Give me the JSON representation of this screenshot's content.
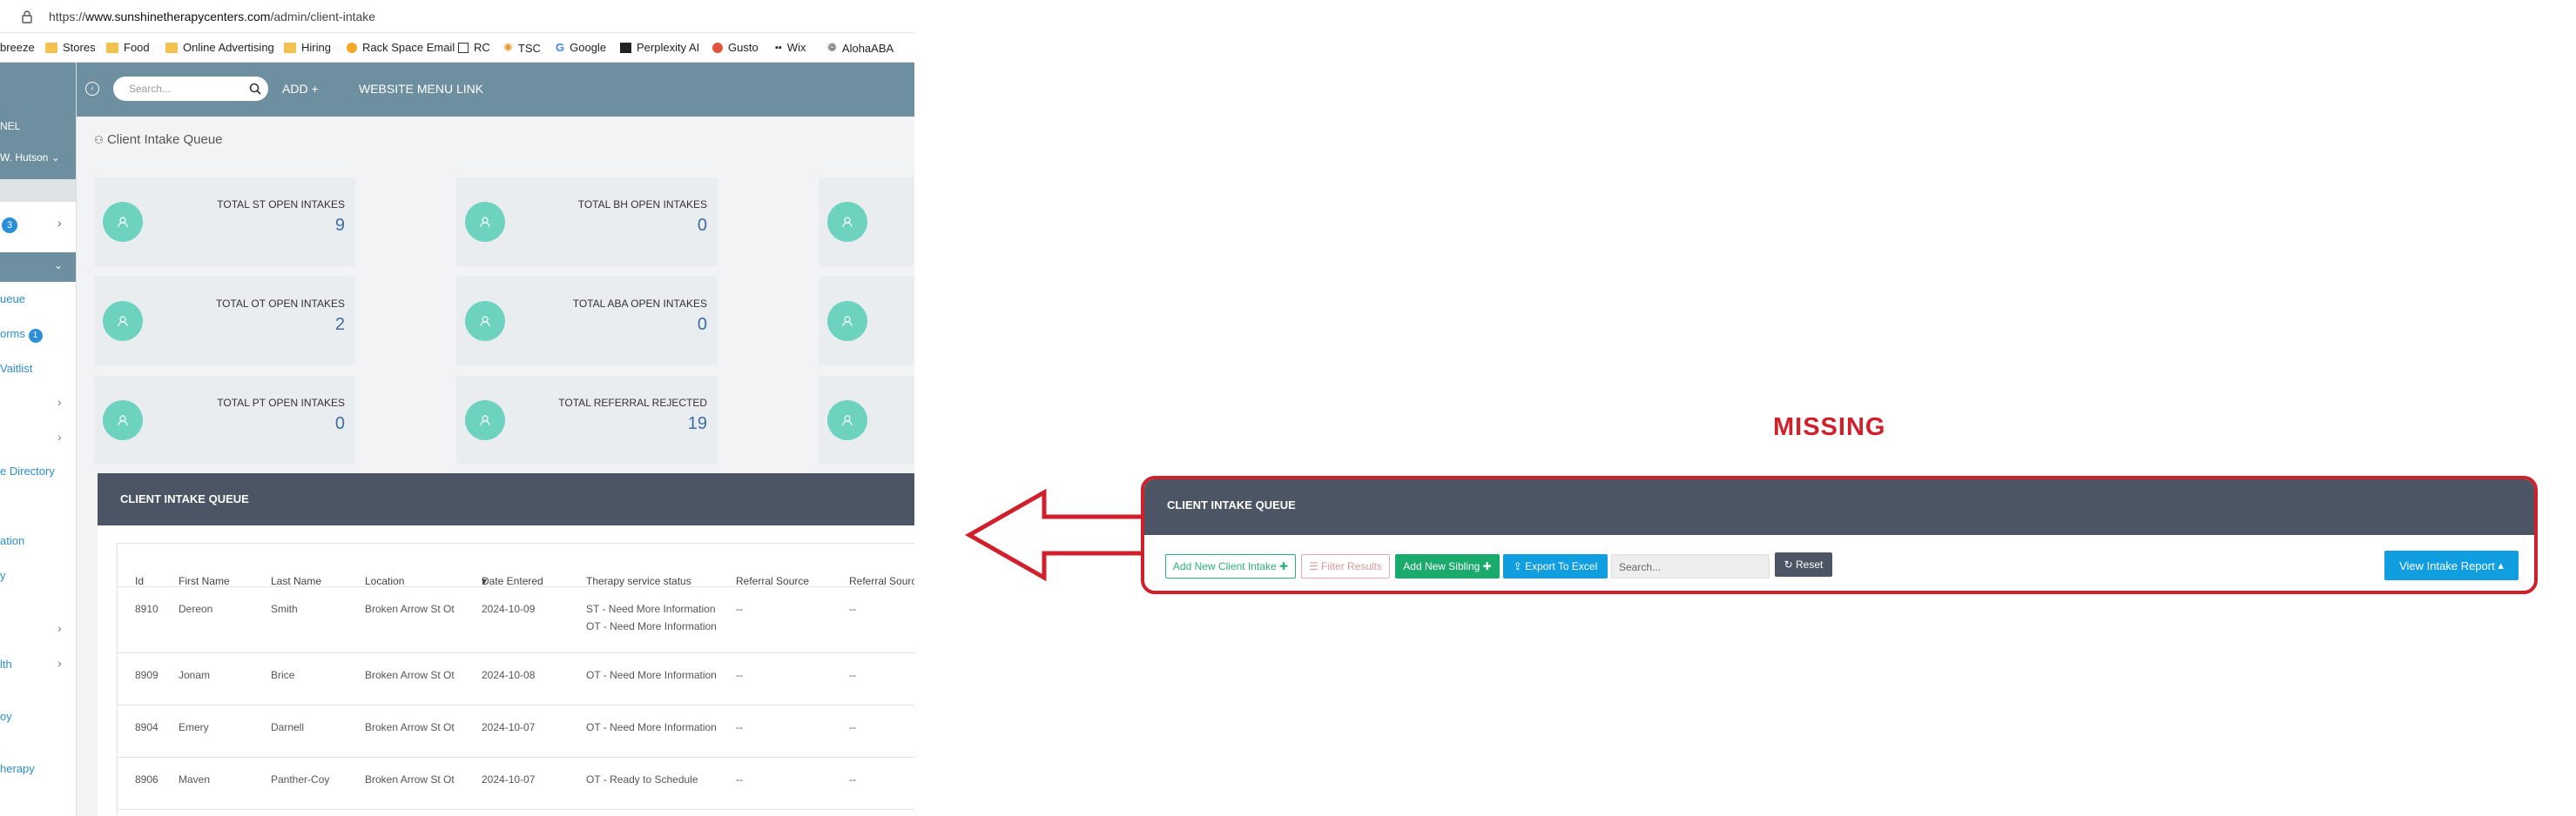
{
  "browser": {
    "url_prefix": "https://",
    "url_domain": "www.sunshinetherapycenters.com",
    "url_path": "/admin/client-intake",
    "bookmarks": [
      "breeze",
      "Stores",
      "Food",
      "Online Advertising",
      "Hiring",
      "Rack Space Email",
      "RC",
      "TSC",
      "Google",
      "Perplexity AI",
      "Gusto",
      "Wix",
      "AlohaABA"
    ]
  },
  "sidebar": {
    "panel_label": "NEL",
    "user": "W. Hutson",
    "badge_top": "3",
    "items": [
      "ueue",
      "orms",
      "Vaitlist",
      "e Directory",
      "ation",
      "y",
      "lth",
      "oy",
      "herapy"
    ],
    "forms_badge": "1"
  },
  "topbar": {
    "search_placeholder": "Search...",
    "add_label": "ADD",
    "website_menu": "WEBSITE MENU LINK"
  },
  "page": {
    "title": "Client Intake Queue"
  },
  "stats": [
    {
      "label": "TOTAL ST OPEN INTAKES",
      "value": "9"
    },
    {
      "label": "TOTAL BH OPEN INTAKES",
      "value": "0"
    },
    {
      "label": "TOTAL OT OPEN INTAKES",
      "value": "2"
    },
    {
      "label": "TOTAL ABA OPEN INTAKES",
      "value": "0"
    },
    {
      "label": "TOTAL PT OPEN INTAKES",
      "value": "0"
    },
    {
      "label": "TOTAL REFERRAL REJECTED",
      "value": "19"
    }
  ],
  "queue": {
    "header": "CLIENT INTAKE QUEUE",
    "columns": [
      "Id",
      "First Name",
      "Last Name",
      "Location",
      "Date Entered",
      "Therapy service status",
      "Referral Source",
      "Referral Sourc"
    ],
    "rows": [
      {
        "id": "8910",
        "first": "Dereon",
        "last": "Smith",
        "location": "Broken Arrow St Ot",
        "date": "2024-10-09",
        "status": "ST - Need More Information",
        "status2": "OT - Need More Information",
        "ref": "--",
        "ref2": "--"
      },
      {
        "id": "8909",
        "first": "Jonam",
        "last": "Brice",
        "location": "Broken Arrow St Ot",
        "date": "2024-10-08",
        "status": "OT - Need More Information",
        "status2": "",
        "ref": "--",
        "ref2": "--"
      },
      {
        "id": "8904",
        "first": "Emery",
        "last": "Darnell",
        "location": "Broken Arrow St Ot",
        "date": "2024-10-07",
        "status": "OT - Need More Information",
        "status2": "",
        "ref": "--",
        "ref2": "--"
      },
      {
        "id": "8906",
        "first": "Maven",
        "last": "Panther-Coy",
        "location": "Broken Arrow St Ot",
        "date": "2024-10-07",
        "status": "OT - Ready to Schedule",
        "status2": "",
        "ref": "--",
        "ref2": "--"
      }
    ]
  },
  "missing": {
    "label": "MISSING",
    "header": "CLIENT INTAKE QUEUE",
    "add_client": "Add New Client Intake",
    "filter": "Filter Results",
    "add_sibling": "Add New Sibling",
    "export": "Export To Excel",
    "search_placeholder": "Search...",
    "reset": "Reset",
    "report": "View Intake Report"
  },
  "colors": {
    "sidebar_header": "#6e8fa0",
    "accent_green": "#6dd3be",
    "value_blue": "#3b6ea6",
    "queue_header": "#4b5564",
    "alert_red": "#d0202b",
    "report_blue": "#119ee0"
  }
}
